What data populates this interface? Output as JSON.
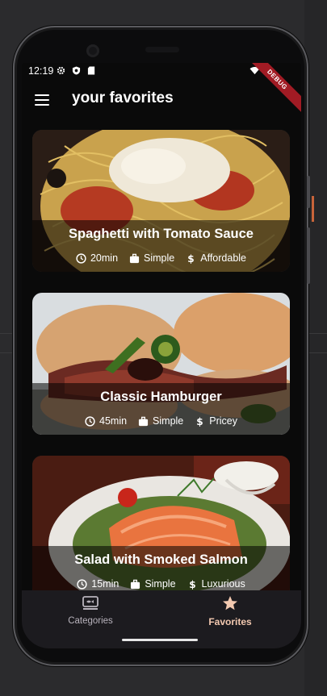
{
  "status_bar": {
    "time": "12:19",
    "debug_banner": "DEBUG"
  },
  "app_bar": {
    "title": "your favorites",
    "menu_icon": "menu-icon"
  },
  "meals": [
    {
      "title": "Spaghetti with Tomato Sauce",
      "duration": "20min",
      "complexity": "Simple",
      "affordability": "Affordable",
      "image": "spaghetti-photo"
    },
    {
      "title": "Classic Hamburger",
      "duration": "45min",
      "complexity": "Simple",
      "affordability": "Pricey",
      "image": "hamburger-photo"
    },
    {
      "title": "Salad with Smoked Salmon",
      "duration": "15min",
      "complexity": "Simple",
      "affordability": "Luxurious",
      "image": "salmon-salad-photo"
    }
  ],
  "bottom_nav": {
    "items": [
      {
        "label": "Categories",
        "icon": "set-meal-icon",
        "selected": false
      },
      {
        "label": "Favorites",
        "icon": "star-icon",
        "selected": true
      }
    ]
  },
  "colors": {
    "selected_nav": "#f3c9b0",
    "nav_background": "#1c1b1f",
    "debug_banner": "#a11b24"
  }
}
